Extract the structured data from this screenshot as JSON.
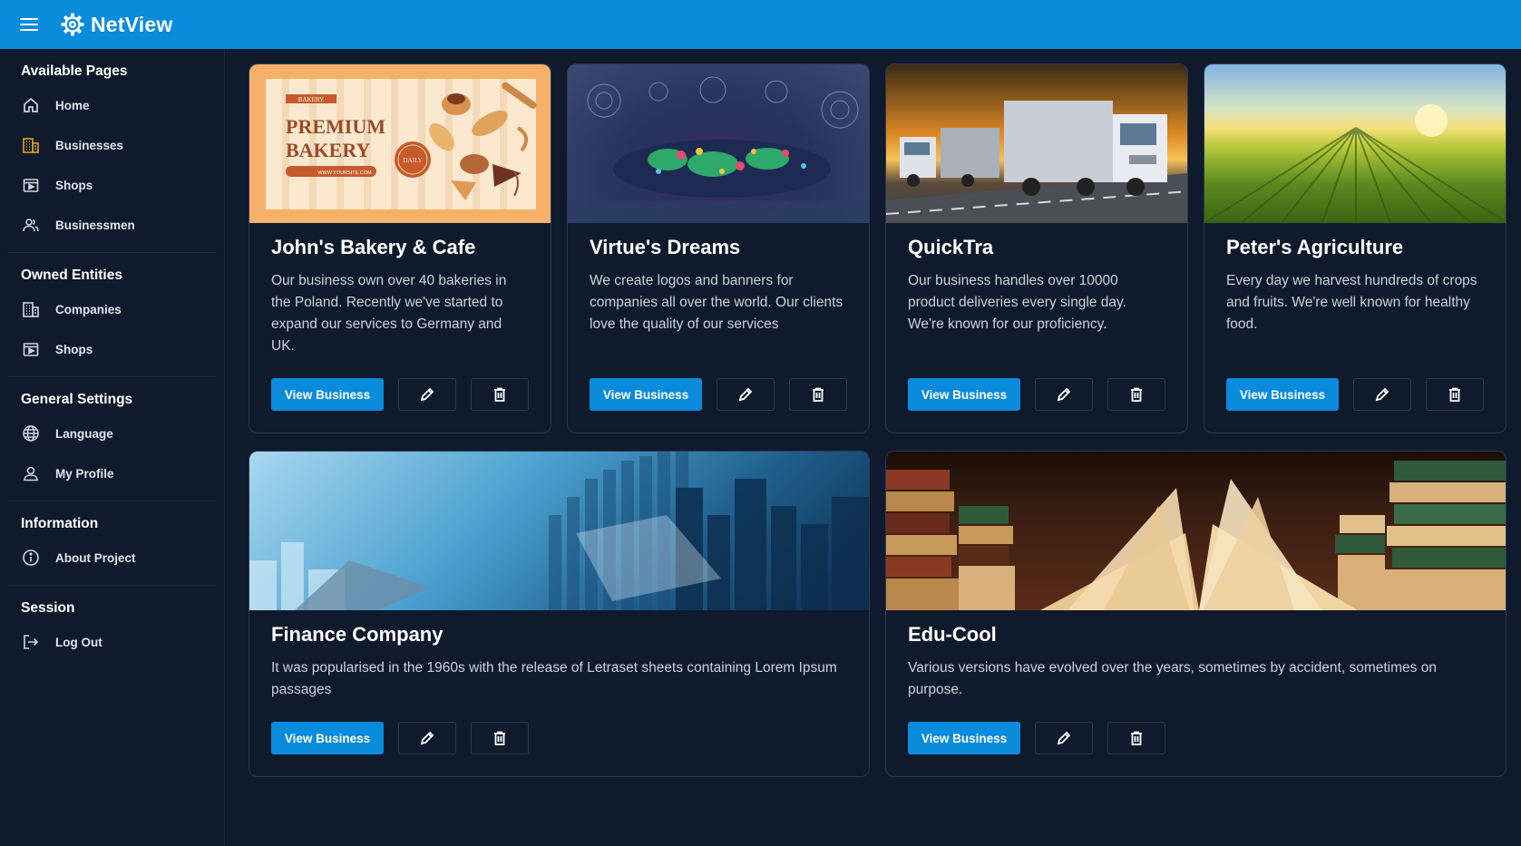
{
  "app": {
    "name": "NetView"
  },
  "sidebar": {
    "sections": [
      {
        "title": "Available Pages",
        "items": [
          {
            "label": "Home",
            "icon": "home-icon"
          },
          {
            "label": "Businesses",
            "icon": "businesses-icon"
          },
          {
            "label": "Shops",
            "icon": "shop-icon"
          },
          {
            "label": "Businessmen",
            "icon": "people-icon"
          }
        ]
      },
      {
        "title": "Owned Entities",
        "items": [
          {
            "label": "Companies",
            "icon": "building-icon"
          },
          {
            "label": "Shops",
            "icon": "shop-icon"
          }
        ]
      },
      {
        "title": "General Settings",
        "items": [
          {
            "label": "Language",
            "icon": "globe-icon"
          },
          {
            "label": "My Profile",
            "icon": "user-icon"
          }
        ]
      },
      {
        "title": "Information",
        "items": [
          {
            "label": "About Project",
            "icon": "info-icon"
          }
        ]
      },
      {
        "title": "Session",
        "items": [
          {
            "label": "Log Out",
            "icon": "logout-icon"
          }
        ]
      }
    ]
  },
  "cards": [
    {
      "title": "John's Bakery & Cafe",
      "description": "Our business own over 40 bakeries in the Poland. Recently we've started to expand our services to Germany and UK.",
      "view_label": "View Business",
      "image": {
        "tag": "BAKERY",
        "line1": "PREMIUM",
        "line2": "BAKERY",
        "badge": "DAILY",
        "url": "WWW.YOURSITE.COM"
      }
    },
    {
      "title": "Virtue's Dreams",
      "description": "We create logos and banners for companies all over the world. Our clients love the quality of our services",
      "view_label": "View Business"
    },
    {
      "title": "QuickTra",
      "description": "Our business handles over 10000 product deliveries every single day. We're known for our proficiency.",
      "view_label": "View Business"
    },
    {
      "title": "Peter's Agriculture",
      "description": "Every day we harvest hundreds of crops and fruits. We're well known for healthy food.",
      "view_label": "View Business"
    },
    {
      "title": "Finance Company",
      "description": "It was popularised in the 1960s with the release of Letraset sheets containing Lorem Ipsum passages",
      "view_label": "View Business"
    },
    {
      "title": "Edu-Cool",
      "description": "Various versions have evolved over the years, sometimes by accident, sometimes on purpose.",
      "view_label": "View Business"
    }
  ],
  "colors": {
    "accent": "#0a8bdc",
    "background": "#0f1a2c",
    "border": "#2c3a50"
  }
}
